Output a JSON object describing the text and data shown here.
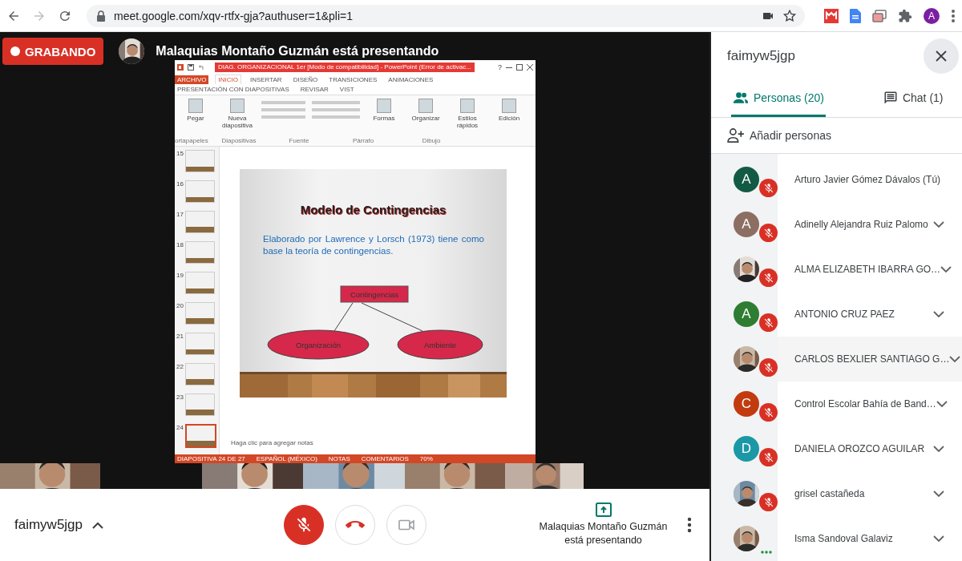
{
  "browser": {
    "url": "meet.google.com/xqv-rtfx-gja?authuser=1&pli=1",
    "profile_initial": "A"
  },
  "stage": {
    "recording_label": "GRABANDO",
    "presenter_banner": "Malaquias Montaño Guzmán está presentando"
  },
  "presentation": {
    "window_title": "DIAG. ORGANIZACIONAL 1er [Modo de compatibilidad] - PowerPoint (Error de activac...",
    "help": "?",
    "tabs": [
      {
        "label": "ARCHIVO",
        "kind": "file",
        "selected": false
      },
      {
        "label": "INICIO",
        "kind": "tab",
        "selected": true
      },
      {
        "label": "INSERTAR",
        "kind": "tab",
        "selected": false
      },
      {
        "label": "DISEÑO",
        "kind": "tab",
        "selected": false
      },
      {
        "label": "TRANSICIONES",
        "kind": "tab",
        "selected": false
      },
      {
        "label": "ANIMACIONES",
        "kind": "tab",
        "selected": false
      },
      {
        "label": "PRESENTACIÓN CON DIAPOSITIVAS",
        "kind": "tab",
        "selected": false
      },
      {
        "label": "REVISAR",
        "kind": "tab",
        "selected": false
      },
      {
        "label": "VIST",
        "kind": "tab",
        "selected": false
      }
    ],
    "ribbon": {
      "buttons": [
        "Pegar",
        "Nueva diapositiva",
        "Formas",
        "Organizar",
        "Estilos rápidos",
        "Edición"
      ],
      "groups": [
        "ortapapeles",
        "Diapositivas",
        "Fuente",
        "Párrafo",
        "Dibujo"
      ]
    },
    "thumbnails": [
      {
        "number": "15",
        "selected": false
      },
      {
        "number": "16",
        "selected": false
      },
      {
        "number": "17",
        "selected": false
      },
      {
        "number": "18",
        "selected": false
      },
      {
        "number": "19",
        "selected": false
      },
      {
        "number": "20",
        "selected": false
      },
      {
        "number": "21",
        "selected": false
      },
      {
        "number": "22",
        "selected": false
      },
      {
        "number": "23",
        "selected": false
      },
      {
        "number": "24",
        "selected": true
      }
    ],
    "slide": {
      "title": "Modelo de Contingencias",
      "body": "Elaborado por Lawrence y Lorsch (1973) tiene como base la teoría de contingencias.",
      "diagram": {
        "root": "Contingencias",
        "children": [
          "Organización",
          "Ambiente"
        ]
      }
    },
    "notes_placeholder": "Haga clic para agregar notas",
    "status_bar": [
      "DIAPOSITIVA 24 DE 27",
      "ESPAÑOL (MÉXICO)",
      "NOTAS",
      "COMENTARIOS",
      "70%"
    ]
  },
  "panel": {
    "meeting_code": "faimyw5jgp",
    "tabs": [
      {
        "label": "Personas (20)",
        "kind": "people",
        "selected": true
      },
      {
        "label": "Chat (1)",
        "kind": "chat",
        "selected": false
      }
    ],
    "add_people": "Añadir personas",
    "participants": [
      {
        "name": "Arturo Javier Gómez Dávalos (Tú)",
        "kind": "letter",
        "letter": "A",
        "color": "#135a44",
        "muted": true,
        "expandable": false,
        "highlighted": false
      },
      {
        "name": "Adinelly Alejandra Ruiz Palomo",
        "kind": "letter",
        "letter": "A",
        "color": "#8d6e63",
        "muted": true,
        "expandable": true,
        "highlighted": false
      },
      {
        "name": "ALMA ELIZABETH IBARRA GO…",
        "muted": true,
        "expandable": true,
        "highlighted": false
      },
      {
        "name": "ANTONIO CRUZ PAEZ",
        "kind": "letter",
        "letter": "A",
        "color": "#2e7d32",
        "muted": true,
        "expandable": true,
        "highlighted": false
      },
      {
        "name": "CARLOS BEXLIER SANTIAGO G…",
        "muted": true,
        "expandable": true,
        "highlighted": true
      },
      {
        "name": "Control Escolar Bahía de Band…",
        "kind": "letter",
        "letter": "C",
        "color": "#c23b0f",
        "muted": true,
        "expandable": true,
        "highlighted": false
      },
      {
        "name": "DANIELA OROZCO AGUILAR",
        "kind": "letter",
        "letter": "D",
        "color": "#1a98a6",
        "muted": true,
        "expandable": true,
        "highlighted": false
      },
      {
        "name": "grisel castañeda",
        "muted": true,
        "expandable": true,
        "highlighted": false
      },
      {
        "name": "Isma Sandoval Galaviz",
        "muted": false,
        "expandable": true,
        "highlighted": false
      }
    ]
  },
  "call_bar": {
    "meeting_code": "faimyw5jgp",
    "mic_muted": true,
    "camera_on": false,
    "presenting": "Malaquias Montaño Guzmán está presentando"
  }
}
